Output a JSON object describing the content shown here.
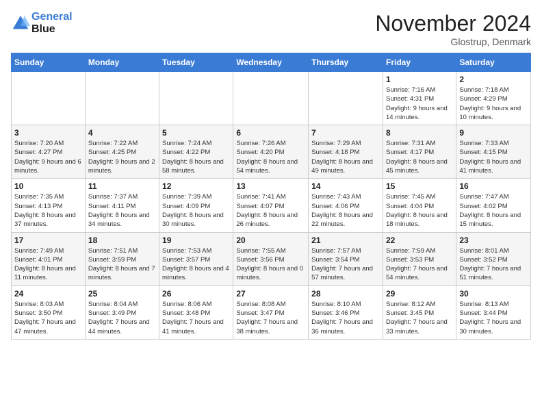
{
  "header": {
    "logo_line1": "General",
    "logo_line2": "Blue",
    "month_title": "November 2024",
    "location": "Glostrup, Denmark"
  },
  "weekdays": [
    "Sunday",
    "Monday",
    "Tuesday",
    "Wednesday",
    "Thursday",
    "Friday",
    "Saturday"
  ],
  "weeks": [
    [
      {
        "day": "",
        "detail": ""
      },
      {
        "day": "",
        "detail": ""
      },
      {
        "day": "",
        "detail": ""
      },
      {
        "day": "",
        "detail": ""
      },
      {
        "day": "",
        "detail": ""
      },
      {
        "day": "1",
        "detail": "Sunrise: 7:16 AM\nSunset: 4:31 PM\nDaylight: 9 hours and 14 minutes."
      },
      {
        "day": "2",
        "detail": "Sunrise: 7:18 AM\nSunset: 4:29 PM\nDaylight: 9 hours and 10 minutes."
      }
    ],
    [
      {
        "day": "3",
        "detail": "Sunrise: 7:20 AM\nSunset: 4:27 PM\nDaylight: 9 hours and 6 minutes."
      },
      {
        "day": "4",
        "detail": "Sunrise: 7:22 AM\nSunset: 4:25 PM\nDaylight: 9 hours and 2 minutes."
      },
      {
        "day": "5",
        "detail": "Sunrise: 7:24 AM\nSunset: 4:22 PM\nDaylight: 8 hours and 58 minutes."
      },
      {
        "day": "6",
        "detail": "Sunrise: 7:26 AM\nSunset: 4:20 PM\nDaylight: 8 hours and 54 minutes."
      },
      {
        "day": "7",
        "detail": "Sunrise: 7:29 AM\nSunset: 4:18 PM\nDaylight: 8 hours and 49 minutes."
      },
      {
        "day": "8",
        "detail": "Sunrise: 7:31 AM\nSunset: 4:17 PM\nDaylight: 8 hours and 45 minutes."
      },
      {
        "day": "9",
        "detail": "Sunrise: 7:33 AM\nSunset: 4:15 PM\nDaylight: 8 hours and 41 minutes."
      }
    ],
    [
      {
        "day": "10",
        "detail": "Sunrise: 7:35 AM\nSunset: 4:13 PM\nDaylight: 8 hours and 37 minutes."
      },
      {
        "day": "11",
        "detail": "Sunrise: 7:37 AM\nSunset: 4:11 PM\nDaylight: 8 hours and 34 minutes."
      },
      {
        "day": "12",
        "detail": "Sunrise: 7:39 AM\nSunset: 4:09 PM\nDaylight: 8 hours and 30 minutes."
      },
      {
        "day": "13",
        "detail": "Sunrise: 7:41 AM\nSunset: 4:07 PM\nDaylight: 8 hours and 26 minutes."
      },
      {
        "day": "14",
        "detail": "Sunrise: 7:43 AM\nSunset: 4:06 PM\nDaylight: 8 hours and 22 minutes."
      },
      {
        "day": "15",
        "detail": "Sunrise: 7:45 AM\nSunset: 4:04 PM\nDaylight: 8 hours and 18 minutes."
      },
      {
        "day": "16",
        "detail": "Sunrise: 7:47 AM\nSunset: 4:02 PM\nDaylight: 8 hours and 15 minutes."
      }
    ],
    [
      {
        "day": "17",
        "detail": "Sunrise: 7:49 AM\nSunset: 4:01 PM\nDaylight: 8 hours and 11 minutes."
      },
      {
        "day": "18",
        "detail": "Sunrise: 7:51 AM\nSunset: 3:59 PM\nDaylight: 8 hours and 7 minutes."
      },
      {
        "day": "19",
        "detail": "Sunrise: 7:53 AM\nSunset: 3:57 PM\nDaylight: 8 hours and 4 minutes."
      },
      {
        "day": "20",
        "detail": "Sunrise: 7:55 AM\nSunset: 3:56 PM\nDaylight: 8 hours and 0 minutes."
      },
      {
        "day": "21",
        "detail": "Sunrise: 7:57 AM\nSunset: 3:54 PM\nDaylight: 7 hours and 57 minutes."
      },
      {
        "day": "22",
        "detail": "Sunrise: 7:59 AM\nSunset: 3:53 PM\nDaylight: 7 hours and 54 minutes."
      },
      {
        "day": "23",
        "detail": "Sunrise: 8:01 AM\nSunset: 3:52 PM\nDaylight: 7 hours and 51 minutes."
      }
    ],
    [
      {
        "day": "24",
        "detail": "Sunrise: 8:03 AM\nSunset: 3:50 PM\nDaylight: 7 hours and 47 minutes."
      },
      {
        "day": "25",
        "detail": "Sunrise: 8:04 AM\nSunset: 3:49 PM\nDaylight: 7 hours and 44 minutes."
      },
      {
        "day": "26",
        "detail": "Sunrise: 8:06 AM\nSunset: 3:48 PM\nDaylight: 7 hours and 41 minutes."
      },
      {
        "day": "27",
        "detail": "Sunrise: 8:08 AM\nSunset: 3:47 PM\nDaylight: 7 hours and 38 minutes."
      },
      {
        "day": "28",
        "detail": "Sunrise: 8:10 AM\nSunset: 3:46 PM\nDaylight: 7 hours and 36 minutes."
      },
      {
        "day": "29",
        "detail": "Sunrise: 8:12 AM\nSunset: 3:45 PM\nDaylight: 7 hours and 33 minutes."
      },
      {
        "day": "30",
        "detail": "Sunrise: 8:13 AM\nSunset: 3:44 PM\nDaylight: 7 hours and 30 minutes."
      }
    ]
  ]
}
